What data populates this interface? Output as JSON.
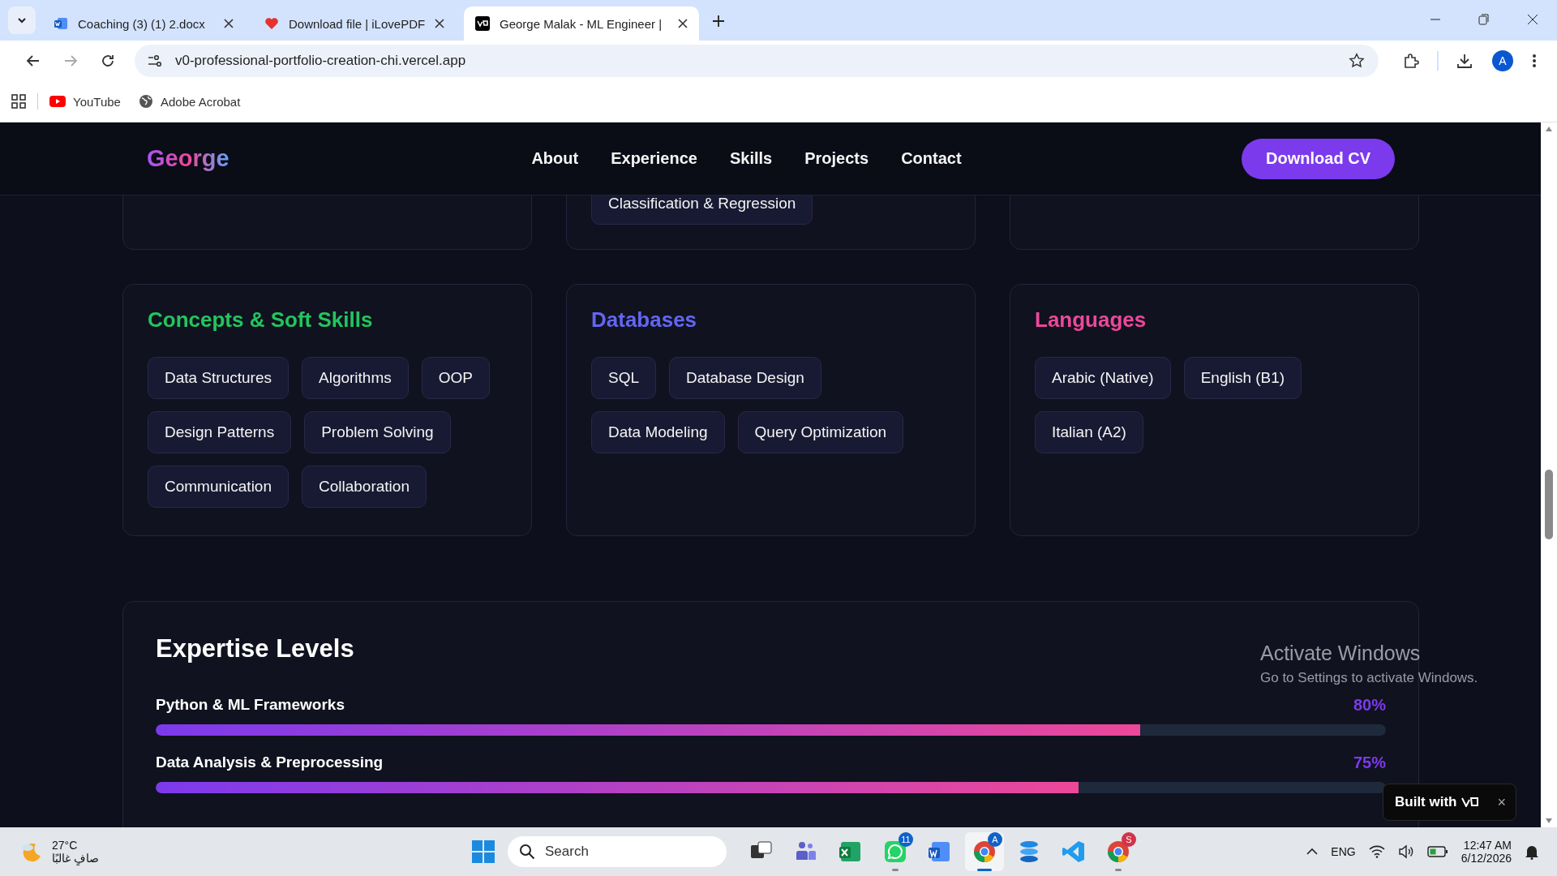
{
  "browser": {
    "tabs": [
      {
        "title": "Coaching (3) (1) 2.docx",
        "kind": "word",
        "selected": false
      },
      {
        "title": "Download file | iLovePDF",
        "kind": "heart",
        "selected": false
      },
      {
        "title": "George Malak - ML Engineer |",
        "kind": "v0",
        "selected": true
      }
    ],
    "address": "v0-professional-portfolio-creation-chi.vercel.app",
    "profile": "A",
    "bookmarks": [
      {
        "label": "YouTube",
        "kind": "youtube"
      },
      {
        "label": "Adobe Acrobat",
        "kind": "globe"
      }
    ]
  },
  "site": {
    "logo": "George",
    "nav": [
      "About",
      "Experience",
      "Skills",
      "Projects",
      "Contact"
    ],
    "cta": "Download CV"
  },
  "skills_above": [
    {
      "kind": "blank"
    },
    {
      "kind": "tags",
      "chips": [
        "Classification & Regression"
      ]
    },
    {
      "kind": "blank"
    }
  ],
  "skill_groups": [
    {
      "title": "Concepts & Soft Skills",
      "color": "#22c55e",
      "chips": [
        "Data Structures",
        "Algorithms",
        "OOP",
        "Design Patterns",
        "Problem Solving",
        "Communication",
        "Collaboration"
      ]
    },
    {
      "title": "Databases",
      "color": "#6366f1",
      "chips": [
        "SQL",
        "Database Design",
        "Data Modeling",
        "Query Optimization"
      ]
    },
    {
      "title": "Languages",
      "color": "#ec4899",
      "chips": [
        "Arabic (Native)",
        "English (B1)",
        "Italian (A2)"
      ]
    }
  ],
  "expertise": {
    "title": "Expertise Levels",
    "items": [
      {
        "name": "Python & ML Frameworks",
        "reading": "80%",
        "level": 0.8
      },
      {
        "name": "Data Analysis & Preprocessing",
        "reading": "75%",
        "level": 0.75
      }
    ]
  },
  "os_notice": {
    "title": "Activate Windows",
    "text": "Go to Settings to activate Windows."
  },
  "badge": {
    "text": "Built with",
    "close": "×"
  },
  "taskbar": {
    "weather": {
      "temp": "27°C",
      "text": "صافٍ غالبًا"
    },
    "search": {
      "placeholder": "Search"
    },
    "apps": [
      {
        "kind": "taskview",
        "selected": false,
        "running": false
      },
      {
        "kind": "teams",
        "selected": false,
        "running": false
      },
      {
        "kind": "excel",
        "selected": false,
        "running": false
      },
      {
        "kind": "whatsapp",
        "badge": "11",
        "selected": false,
        "running": true
      },
      {
        "kind": "word",
        "selected": false,
        "running": false
      },
      {
        "kind": "chrome",
        "badge": "A",
        "selected": true,
        "running": true
      },
      {
        "kind": "stack",
        "selected": false,
        "running": false
      },
      {
        "kind": "vscode",
        "selected": false,
        "running": false
      },
      {
        "kind": "chrome",
        "badge": "S",
        "selected": false,
        "running": true
      }
    ],
    "lang": "ENG",
    "time": "12:47 AM",
    "date": "6/12/2026"
  }
}
